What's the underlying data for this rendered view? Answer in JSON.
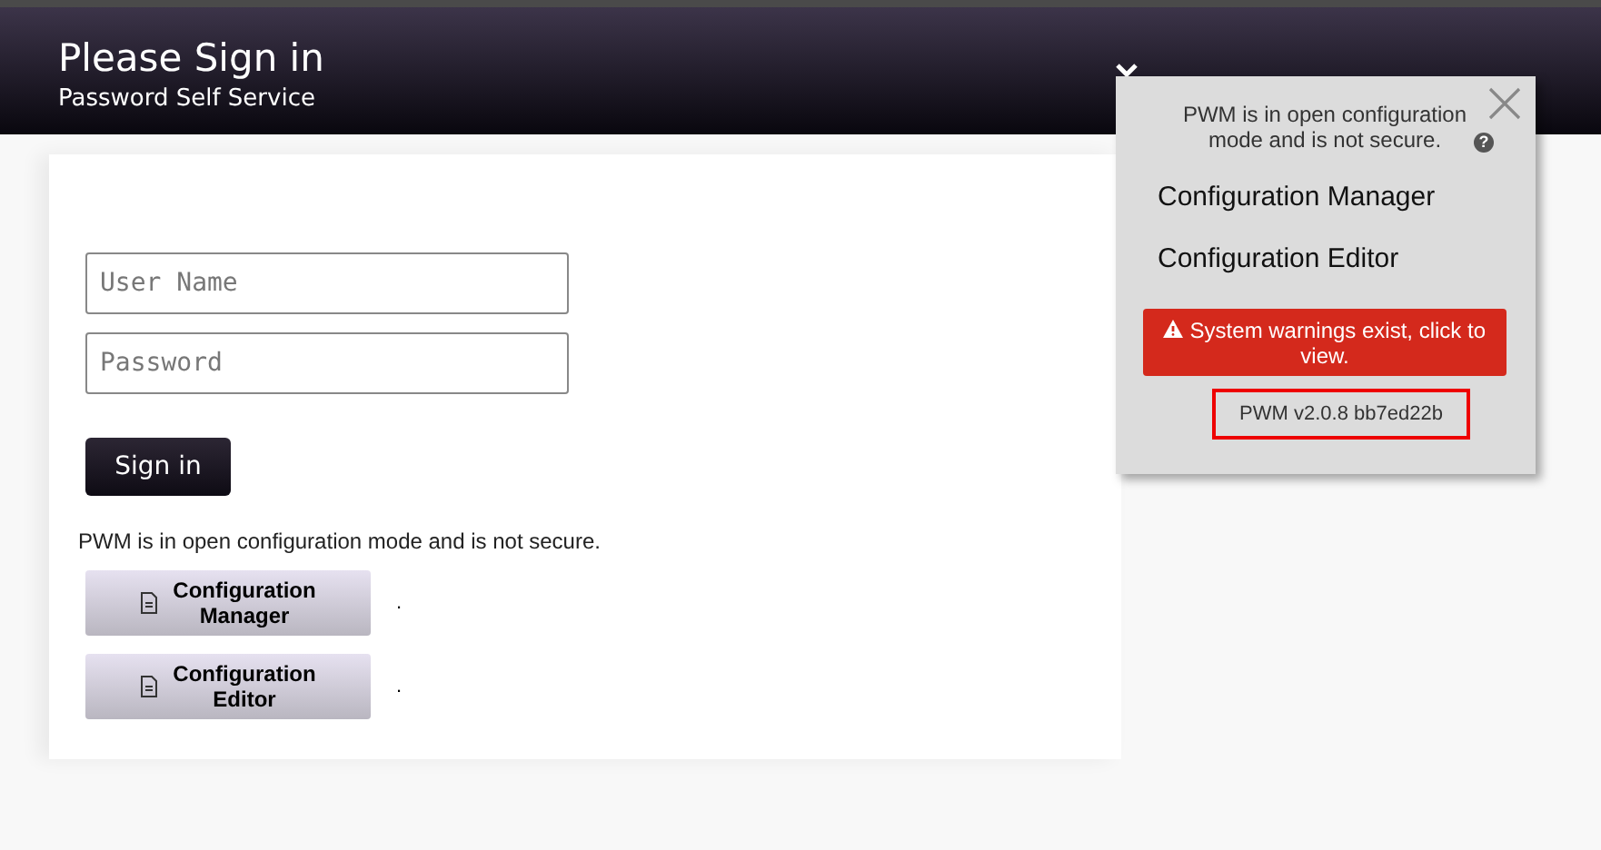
{
  "header": {
    "title": "Please Sign in",
    "subtitle": "Password Self Service"
  },
  "form": {
    "fields": [
      {
        "placeholder": "User Name"
      },
      {
        "placeholder": "Password"
      }
    ],
    "submit": "Sign in"
  },
  "notice": "PWM is in open configuration mode and is not secure.",
  "config_buttons": [
    {
      "label": "Configuration Manager",
      "after": "."
    },
    {
      "label": "Configuration Editor",
      "after": "."
    }
  ],
  "popup": {
    "message": "PWM is in open configuration mode and is not secure.",
    "help": "?",
    "links": [
      "Configuration Manager",
      "Configuration Editor"
    ],
    "warning": "System warnings exist, click to view.",
    "version": "PWM v2.0.8 bb7ed22b"
  }
}
